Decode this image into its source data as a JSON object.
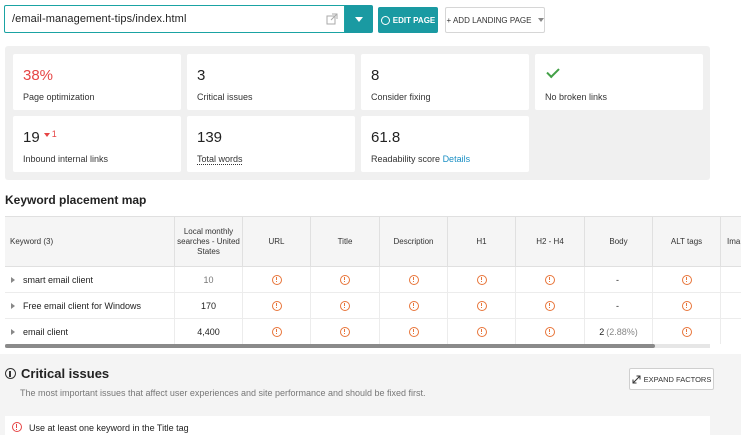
{
  "topbar": {
    "url": "/email-management-tips/index.html",
    "edit_label": "EDIT PAGE",
    "add_label": "+ ADD LANDING PAGE"
  },
  "metrics": {
    "optimization": {
      "value": "38%",
      "label": "Page optimization"
    },
    "critical": {
      "value": "3",
      "label": "Critical issues"
    },
    "consider": {
      "value": "8",
      "label": "Consider fixing"
    },
    "broken": {
      "label": "No broken links"
    },
    "inbound": {
      "value": "19",
      "delta": "1",
      "label": "Inbound internal links"
    },
    "words": {
      "value": "139",
      "label": "Total words"
    },
    "readability": {
      "value": "61.8",
      "label": "Readability score",
      "link": "Details"
    }
  },
  "keyword_map": {
    "title": "Keyword placement map",
    "headers": [
      "Keyword (3)",
      "Local monthly searches - United States",
      "URL",
      "Title",
      "Description",
      "H1",
      "H2 - H4",
      "Body",
      "ALT tags",
      "Ima"
    ],
    "rows": [
      {
        "keyword": "smart email client",
        "searches": "10",
        "body": "-",
        "body_pct": ""
      },
      {
        "keyword": "Free email client for Windows",
        "searches": "170",
        "body": "-",
        "body_pct": ""
      },
      {
        "keyword": "email client",
        "searches": "4,400",
        "body": "2",
        "body_pct": "(2.88%)"
      }
    ]
  },
  "critical_issues": {
    "title": "Critical issues",
    "description": "The most important issues that affect user experiences and site performance and should be fixed first.",
    "expand_label": "EXPAND FACTORS",
    "items": [
      "Use at least one keyword in the Title tag"
    ]
  },
  "colors": {
    "accent": "#1a9aa2",
    "warning": "#e8753a",
    "error": "#e64545",
    "success": "#43a047"
  }
}
